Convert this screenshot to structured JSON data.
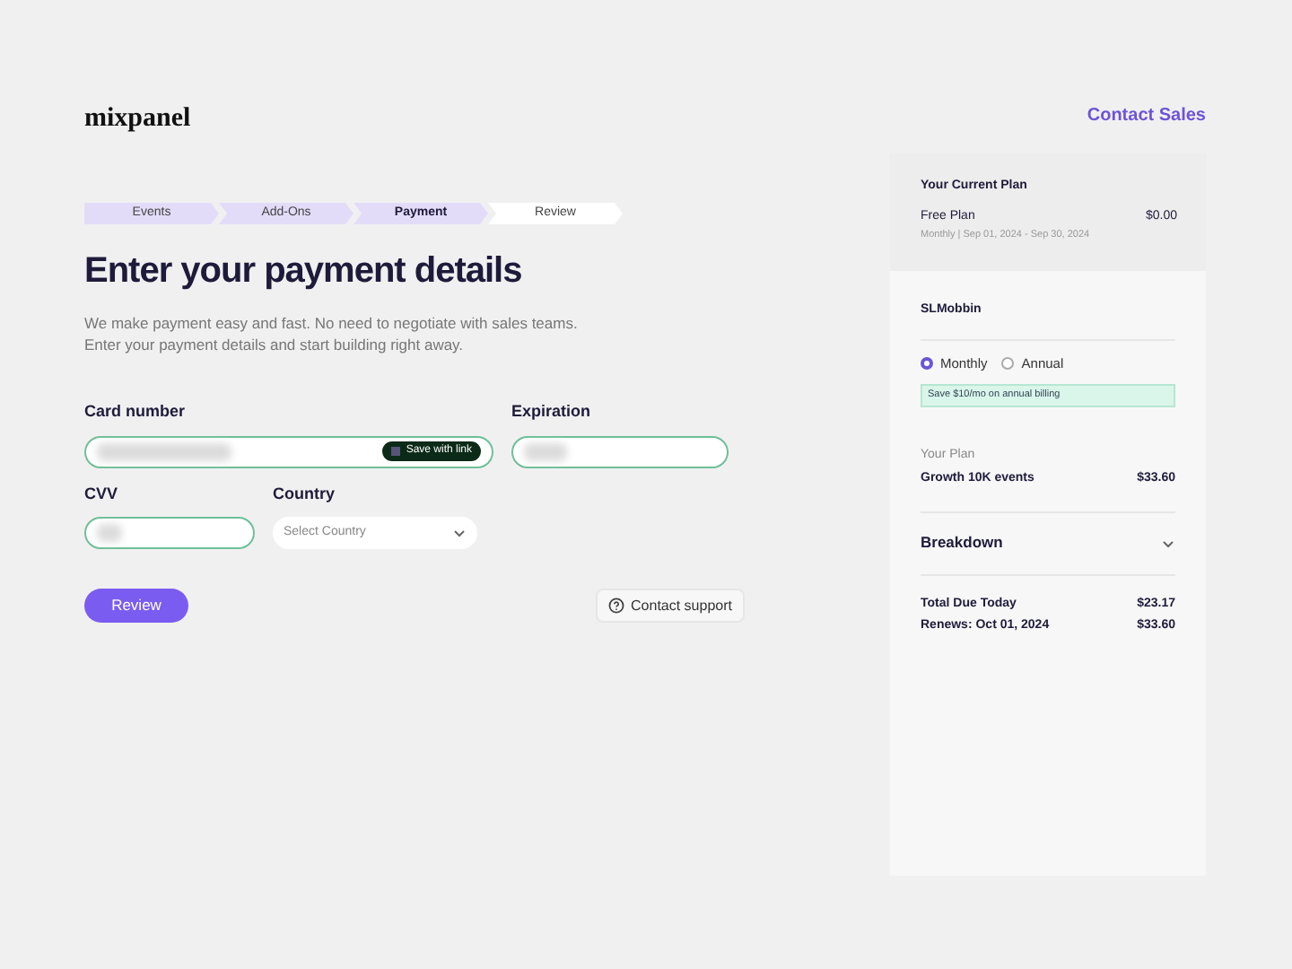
{
  "header": {
    "logo": "mixpanel",
    "contact_sales": "Contact Sales"
  },
  "steps": [
    {
      "label": "Events",
      "completed": true,
      "selected": false
    },
    {
      "label": "Add-Ons",
      "completed": true,
      "selected": false
    },
    {
      "label": "Payment",
      "completed": true,
      "selected": true
    },
    {
      "label": "Review",
      "completed": false,
      "selected": false
    }
  ],
  "title": "Enter your payment details",
  "intro": [
    "We make payment easy and fast. No need to negotiate with sales teams.",
    "Enter your payment details and start building right away."
  ],
  "form": {
    "card_label": "Card number",
    "save_link": "Save with link",
    "expiration_label": "Expiration",
    "cvv_label": "CVV",
    "country_label": "Country",
    "country_placeholder": "Select Country",
    "review_button": "Review",
    "support_button": "Contact support"
  },
  "summary": {
    "current_plan_heading": "Your Current Plan",
    "current_plan": "Free Plan",
    "current_price": "$0.00",
    "period": "Monthly | Sep 01, 2024 - Sep 30, 2024",
    "account": "SLMobbin",
    "billing": [
      {
        "label": "Monthly",
        "selected": true
      },
      {
        "label": "Annual",
        "selected": false
      }
    ],
    "savings_note": "Save $10/mo on annual billing",
    "plan_heading": "Your Plan",
    "plan": "Growth 10K events",
    "plan_price": "$33.60",
    "breakdown": "Breakdown",
    "breakdown_expanded": false,
    "totals": [
      {
        "label": "Total Due Today",
        "value": "$23.17"
      },
      {
        "label": "Renews: Oct 01, 2024",
        "value": "$33.60"
      }
    ]
  }
}
